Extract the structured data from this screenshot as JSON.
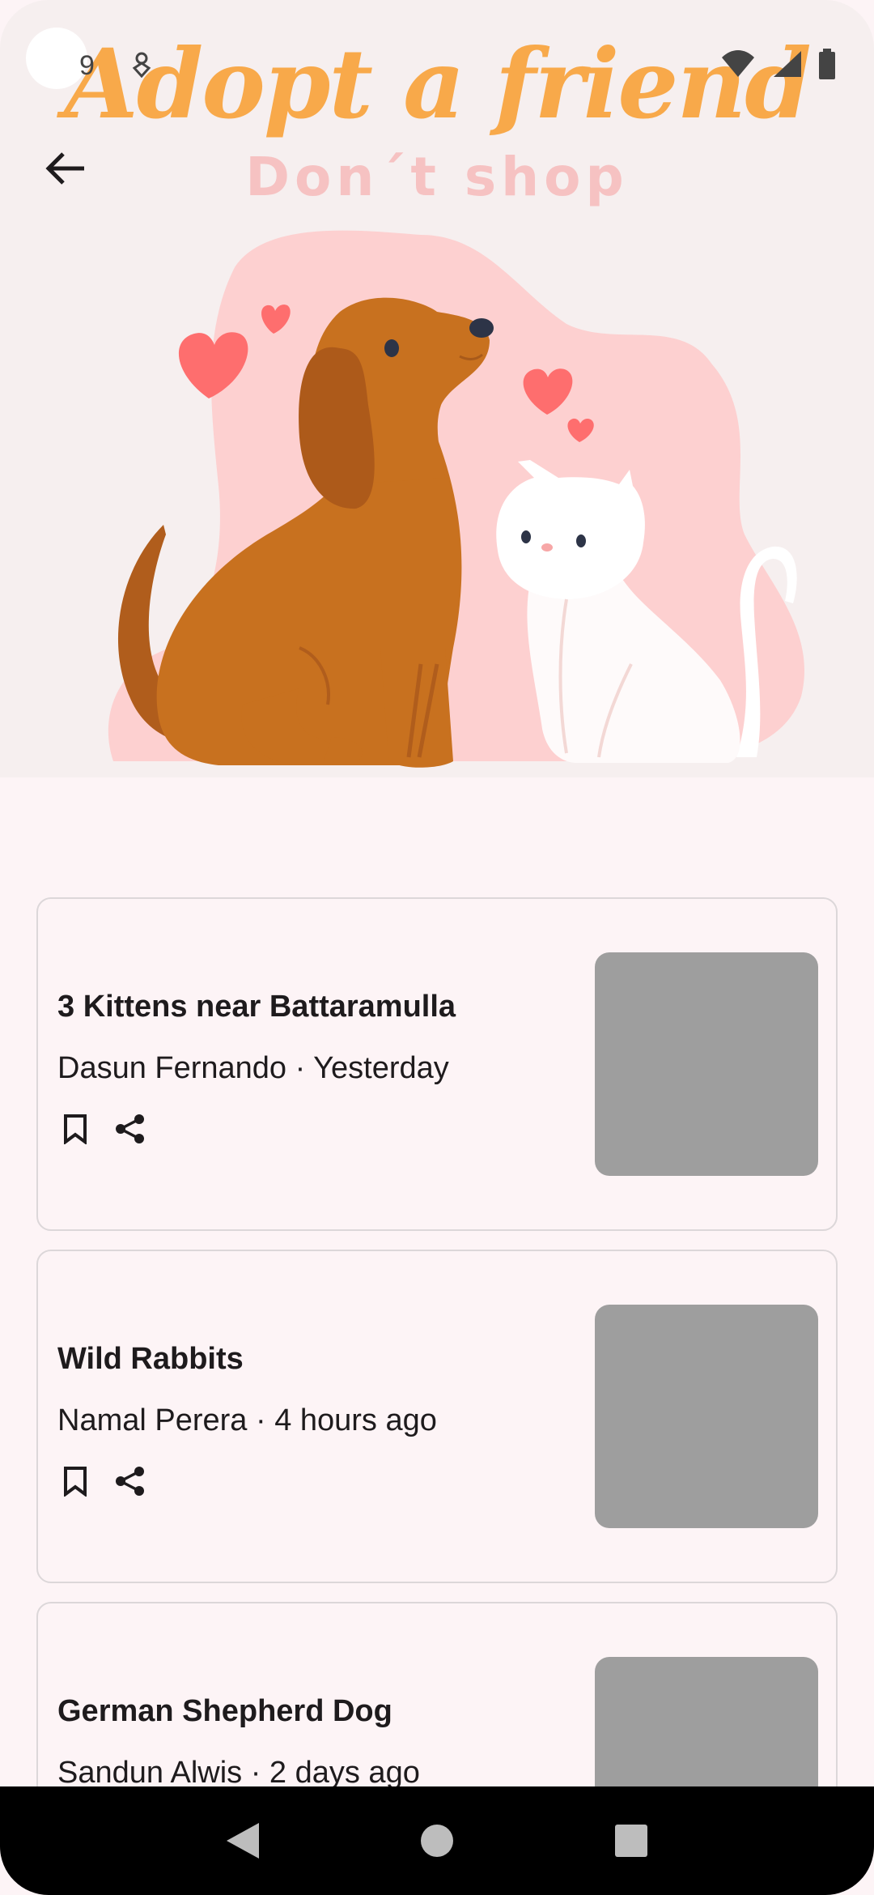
{
  "status_bar": {
    "time": "9",
    "icons": [
      "notification-icon",
      "wifi-icon",
      "signal-icon",
      "battery-icon"
    ]
  },
  "hero": {
    "title": "Adopt a friend",
    "subtitle": "Don´t shop",
    "colors": {
      "title": "#f8a94a",
      "subtitle": "#f6c2c2",
      "background": "#f6efef"
    }
  },
  "toolbar": {
    "back_icon": "arrow-left-icon"
  },
  "listings": [
    {
      "title": "3 Kittens near Battaramulla",
      "meta": "Dasun Fernando · Yesterday"
    },
    {
      "title": "Wild Rabbits",
      "meta": "Namal Perera · 4 hours ago"
    },
    {
      "title": "German Shepherd Dog",
      "meta": "Sandun Alwis · 2 days ago"
    }
  ],
  "card_icons": [
    "bookmark-icon",
    "share-icon"
  ],
  "nav": {
    "icons": [
      "back-triangle-icon",
      "home-circle-icon",
      "recents-square-icon"
    ]
  }
}
